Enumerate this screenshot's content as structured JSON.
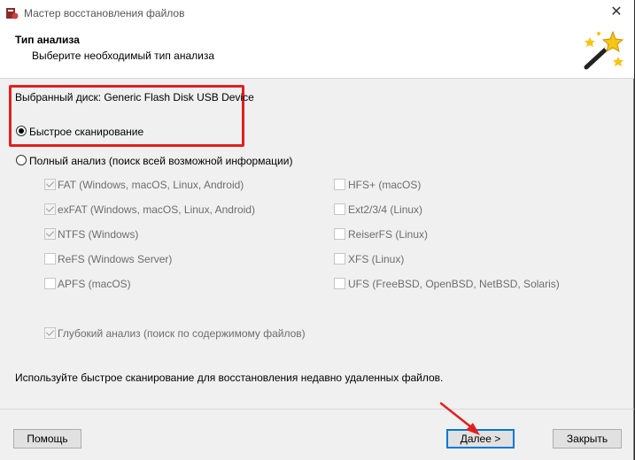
{
  "window": {
    "title": "Мастер восстановления файлов",
    "close_glyph": "✕"
  },
  "header": {
    "title": "Тип анализа",
    "subtitle": "Выберите необходимый тип анализа"
  },
  "disk": {
    "label": "Выбранный диск: Generic Flash Disk USB Device"
  },
  "options": {
    "quick": {
      "label": "Быстрое сканирование",
      "selected": true
    },
    "full": {
      "label": "Полный анализ (поиск всей возможной информации)",
      "selected": false
    }
  },
  "filesystems_left": [
    {
      "label": "FAT (Windows, macOS, Linux, Android)",
      "checked": true
    },
    {
      "label": "exFAT (Windows, macOS, Linux, Android)",
      "checked": true
    },
    {
      "label": "NTFS (Windows)",
      "checked": true
    },
    {
      "label": "ReFS (Windows Server)",
      "checked": false
    },
    {
      "label": "APFS (macOS)",
      "checked": false
    }
  ],
  "filesystems_right": [
    {
      "label": "HFS+ (macOS)",
      "checked": false
    },
    {
      "label": "Ext2/3/4 (Linux)",
      "checked": false
    },
    {
      "label": "ReiserFS (Linux)",
      "checked": false
    },
    {
      "label": "XFS (Linux)",
      "checked": false
    },
    {
      "label": "UFS (FreeBSD, OpenBSD, NetBSD, Solaris)",
      "checked": false
    }
  ],
  "deep": {
    "label": "Глубокий анализ (поиск по содержимому файлов)",
    "checked": true
  },
  "hint": "Используйте быстрое сканирование для восстановления недавно удаленных файлов.",
  "buttons": {
    "help": "Помощь",
    "next": "Далее >",
    "close": "Закрыть"
  },
  "colors": {
    "highlight": "#e02020",
    "primary_border": "#0078d7"
  }
}
